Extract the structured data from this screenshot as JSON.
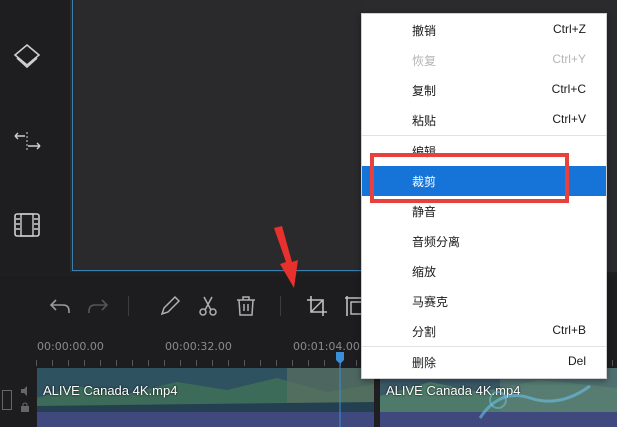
{
  "context_menu": {
    "items": [
      {
        "label": "撤销",
        "shortcut": "Ctrl+Z",
        "disabled": false
      },
      {
        "label": "恢复",
        "shortcut": "Ctrl+Y",
        "disabled": true
      },
      {
        "label": "复制",
        "shortcut": "Ctrl+C",
        "disabled": false
      },
      {
        "label": "粘贴",
        "shortcut": "Ctrl+V",
        "disabled": false
      },
      {
        "label": "编辑",
        "shortcut": "",
        "disabled": false
      },
      {
        "label": "裁剪",
        "shortcut": "",
        "disabled": false,
        "selected": true
      },
      {
        "label": "静音",
        "shortcut": "",
        "disabled": false
      },
      {
        "label": "音频分离",
        "shortcut": "",
        "disabled": false
      },
      {
        "label": "缩放",
        "shortcut": "",
        "disabled": false
      },
      {
        "label": "马赛克",
        "shortcut": "",
        "disabled": false
      },
      {
        "label": "分割",
        "shortcut": "Ctrl+B",
        "disabled": false
      },
      {
        "label": "删除",
        "shortcut": "Del",
        "disabled": false
      }
    ]
  },
  "timeline": {
    "ruler_labels": [
      "00:00:00.00",
      "00:00:32.00",
      "00:01:04.00"
    ],
    "clips": [
      {
        "label": "ALIVE  Canada 4K.mp4"
      },
      {
        "label": "ALIVE  Canada 4K.mp4"
      }
    ]
  },
  "colors": {
    "selection": "#1673d8",
    "highlight": "#e6413c",
    "accent": "#3a8fd6",
    "track": "#29485a",
    "audio_strip": "#40497e"
  },
  "sidebar_icons": [
    "layers-icon",
    "transition-icon",
    "film-icon"
  ],
  "toolbar_icons": [
    "undo-icon",
    "redo-icon",
    "pen-icon",
    "scissors-icon",
    "trash-icon",
    "crop-icon",
    "freeze-frame-icon"
  ]
}
